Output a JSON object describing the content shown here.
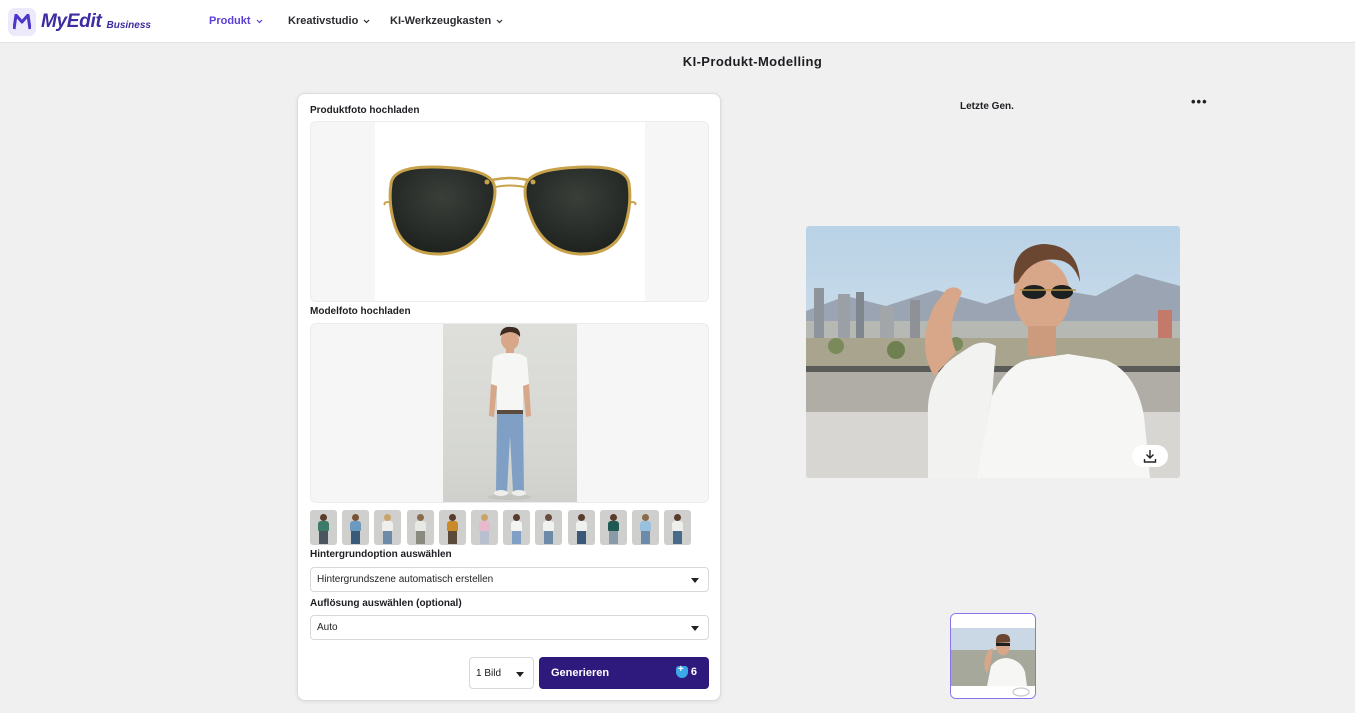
{
  "app": {
    "name": "MyEdit",
    "tier": "Business",
    "brand_color": "#3c2da0",
    "accent_color": "#5b3fd6"
  },
  "nav": {
    "items": [
      {
        "label": "Produkt",
        "active": true
      },
      {
        "label": "Kreativstudio",
        "active": false
      },
      {
        "label": "KI-Werkzeugkasten",
        "active": false
      }
    ]
  },
  "page": {
    "title": "KI-Produkt-Modelling"
  },
  "form": {
    "product_label": "Produktfoto hochladen",
    "product_image_icon": "aviator-sunglasses-image",
    "model_label": "Modelfoto hochladen",
    "model_image_icon": "standing-model-image",
    "model_presets_count": 12,
    "background_label": "Hintergrundoption auswählen",
    "background_value": "Hintergrundszene automatisch erstellen",
    "resolution_label": "Auflösung auswählen (optional)",
    "resolution_value": "Auto",
    "count_value": "1 Bild",
    "generate_label": "Generieren",
    "credits": "6",
    "generate_color": "#2d1a7c"
  },
  "result": {
    "title": "Letzte Gen.",
    "more_icon": "more-horizontal-icon",
    "download_icon": "download-icon"
  }
}
